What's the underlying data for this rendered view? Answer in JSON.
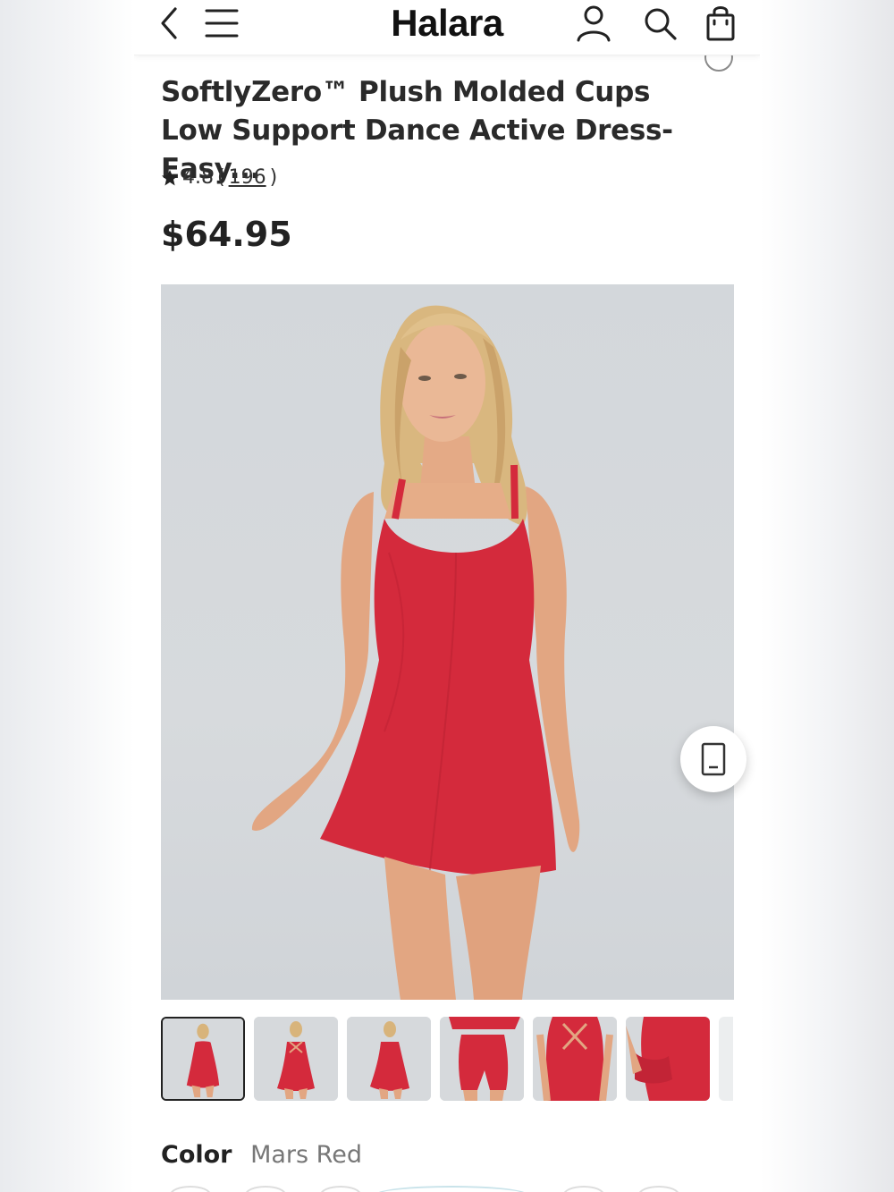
{
  "header": {
    "logo": "Halara",
    "back_icon": "chevron-left-icon",
    "menu_icon": "hamburger-icon",
    "account_icon": "user-icon",
    "search_icon": "search-icon",
    "bag_icon": "shopping-bag-icon"
  },
  "product": {
    "title": "SoftlyZero™ Plush Molded Cups Low Support Dance Active Dress-Easy...",
    "rating": "4.8",
    "review_open": "(",
    "review_count": "196",
    "review_close": ")",
    "price": "$64.95"
  },
  "gallery": {
    "device_icon": "phone-icon",
    "thumbnails": [
      "front",
      "back",
      "front-angle",
      "shorts-detail",
      "back-cross-strap",
      "pocket-detail"
    ],
    "selected_index": 0
  },
  "color": {
    "label": "Color",
    "value": "Mars Red"
  },
  "colors": {
    "dress": "#d42a3c",
    "background": "#d4d8dc",
    "text": "#222222"
  }
}
